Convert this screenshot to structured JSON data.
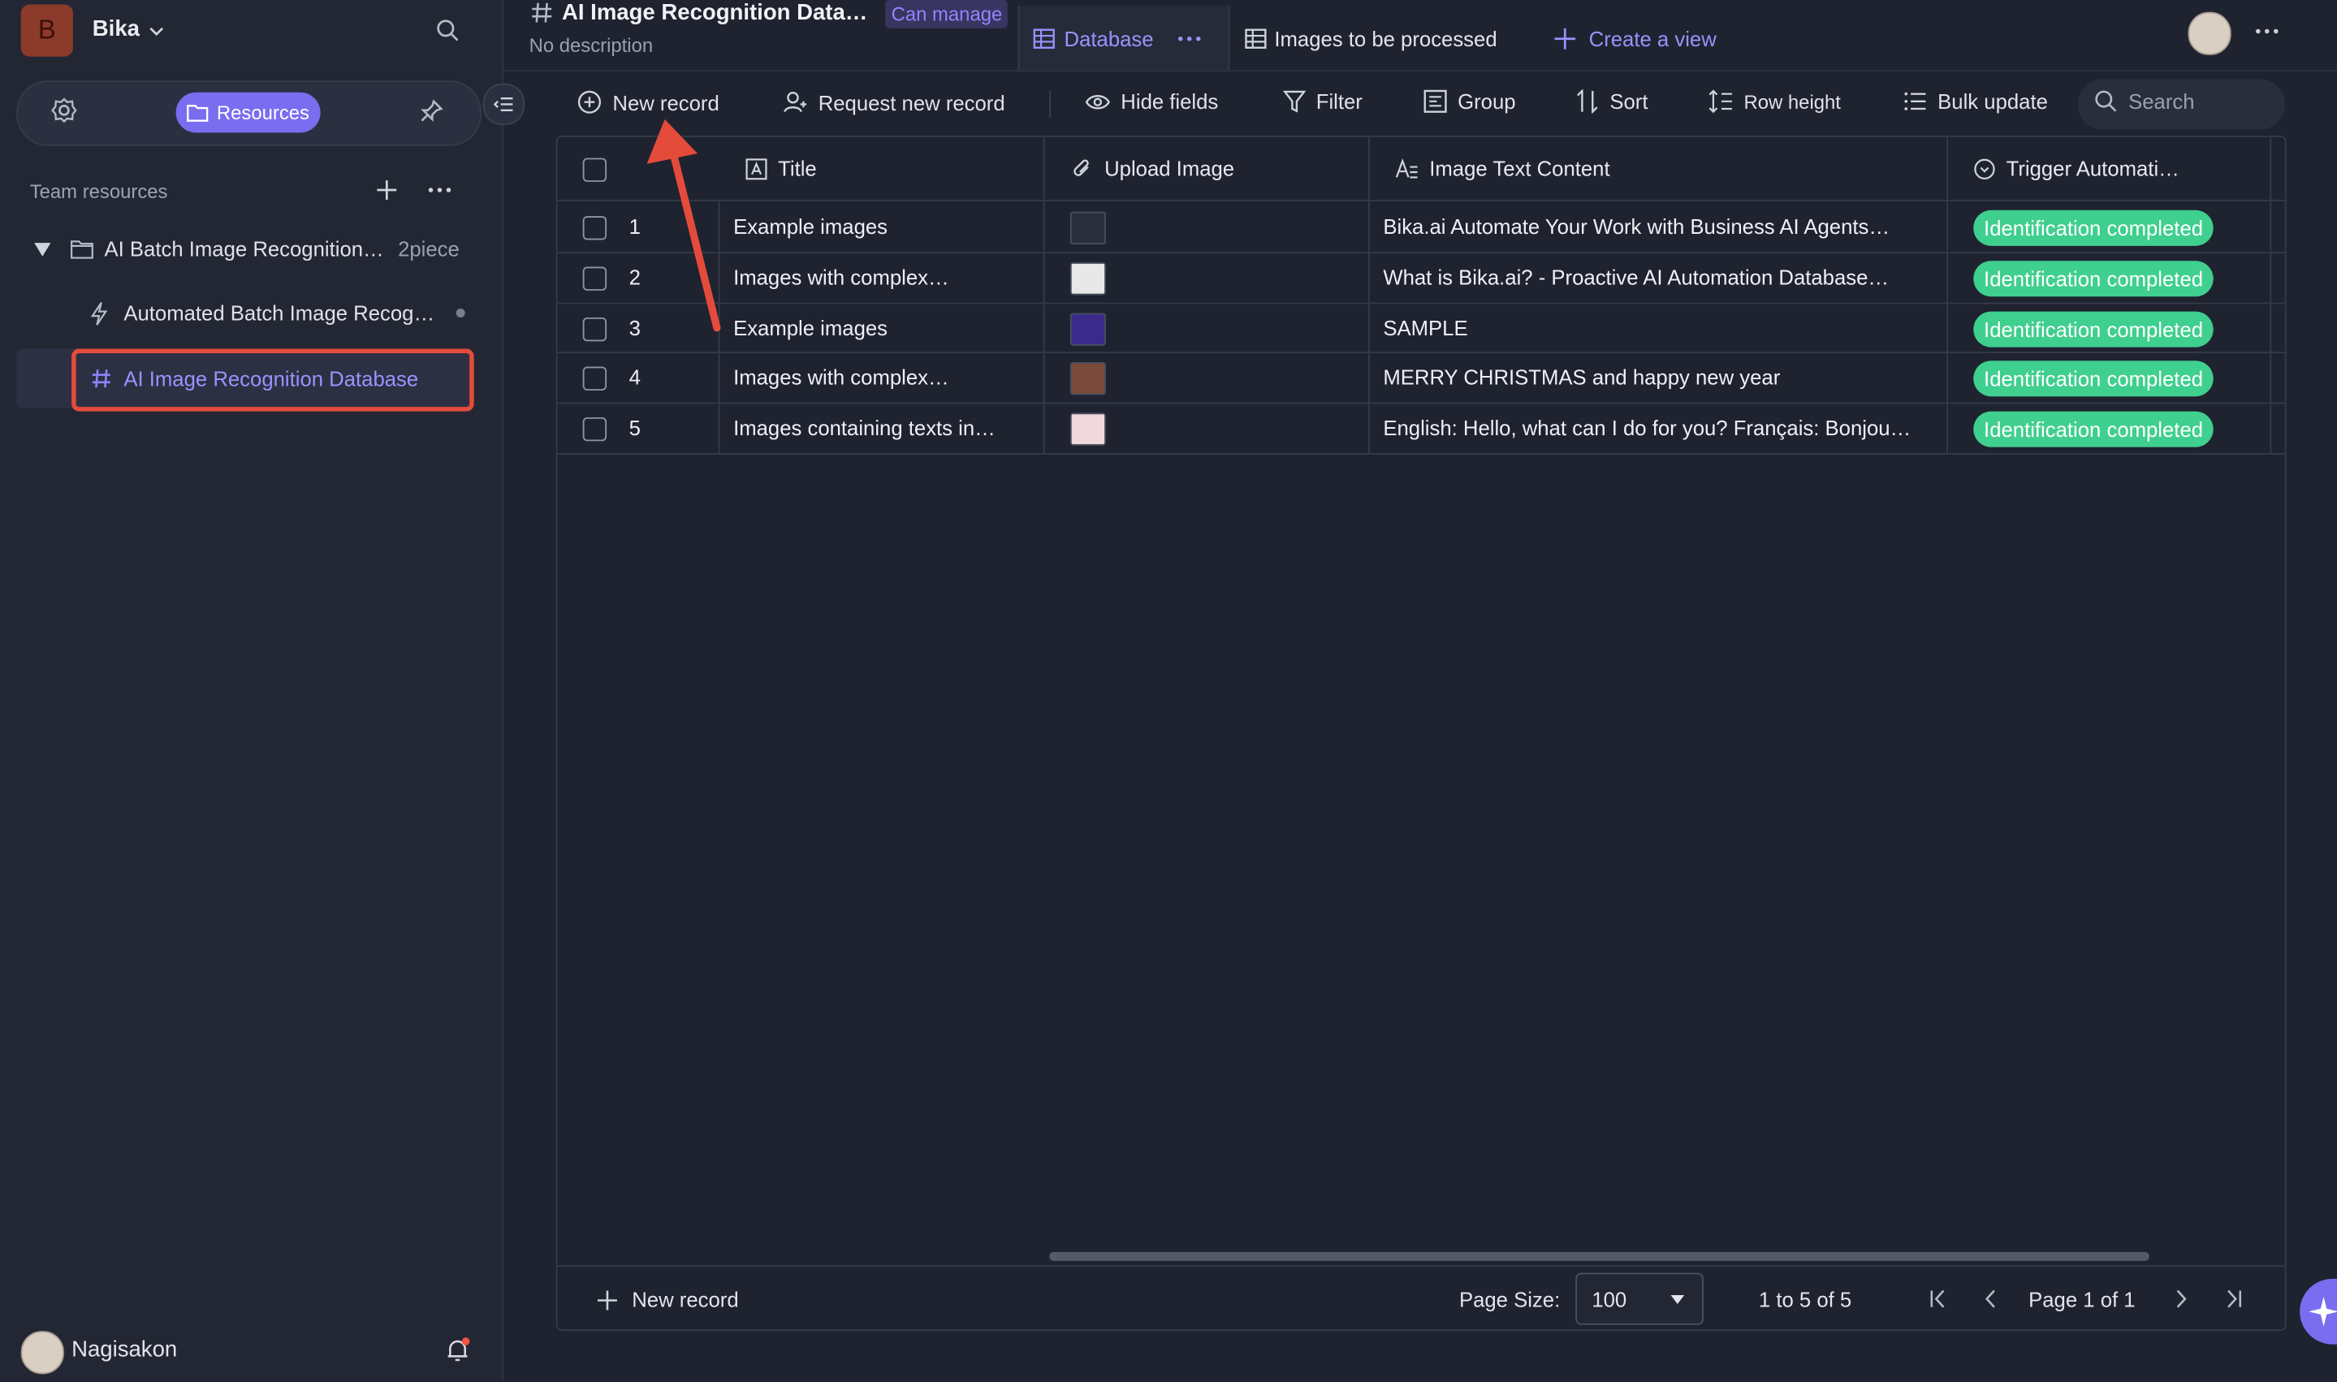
{
  "workspace": {
    "logo_letter": "B",
    "name": "Bika"
  },
  "sidebar": {
    "resources_label": "Resources",
    "team_resources_label": "Team resources",
    "folder": {
      "name": "AI Batch Image Recognition…",
      "count": "2piece"
    },
    "items": [
      {
        "label": "Automated Batch Image Recog…",
        "icon": "automation-icon"
      },
      {
        "label": "AI Image Recognition Database",
        "icon": "database-icon"
      }
    ],
    "user_name": "Nagisakon"
  },
  "header": {
    "title": "AI Image Recognition Data…",
    "permission_badge": "Can manage",
    "description": "No description",
    "tabs": [
      {
        "label": "Database"
      },
      {
        "label": "Images to be processed"
      }
    ],
    "create_view_label": "Create a view"
  },
  "toolbar": {
    "new_record": "New record",
    "request_new_record": "Request new record",
    "hide_fields": "Hide fields",
    "filter": "Filter",
    "group": "Group",
    "sort": "Sort",
    "row_height": "Row height",
    "bulk_update": "Bulk update",
    "search_placeholder": "Search"
  },
  "table": {
    "columns": [
      "Title",
      "Upload Image",
      "Image Text Content",
      "Trigger Automati…"
    ],
    "rows": [
      {
        "num": "1",
        "title": "Example images",
        "text": "Bika.ai Automate Your Work with Business AI Agents…",
        "status": "Identification completed",
        "thumb": "#2b2f3c"
      },
      {
        "num": "2",
        "title": "Images with complex…",
        "text": "What is Bika.ai? - Proactive AI Automation Database…",
        "status": "Identification completed",
        "thumb": "#e8e8e8"
      },
      {
        "num": "3",
        "title": "Example images",
        "text": "SAMPLE",
        "status": "Identification completed",
        "thumb": "#3a2a8a"
      },
      {
        "num": "4",
        "title": "Images with complex…",
        "text": "MERRY CHRISTMAS and happy new year",
        "status": "Identification completed",
        "thumb": "#7a4a3a"
      },
      {
        "num": "5",
        "title": "Images containing texts in…",
        "text": "English: Hello, what can I do for you? Français: Bonjou…",
        "status": "Identification completed",
        "thumb": "#f0d8dc"
      }
    ]
  },
  "footer": {
    "new_record": "New record",
    "page_size_label": "Page Size:",
    "page_size_value": "100",
    "range": "1 to 5 of 5",
    "page_info": "Page 1 of 1"
  },
  "colors": {
    "accent": "#7b6df0",
    "status_green": "#3fcf8e",
    "highlight_red": "#e44b3b"
  }
}
